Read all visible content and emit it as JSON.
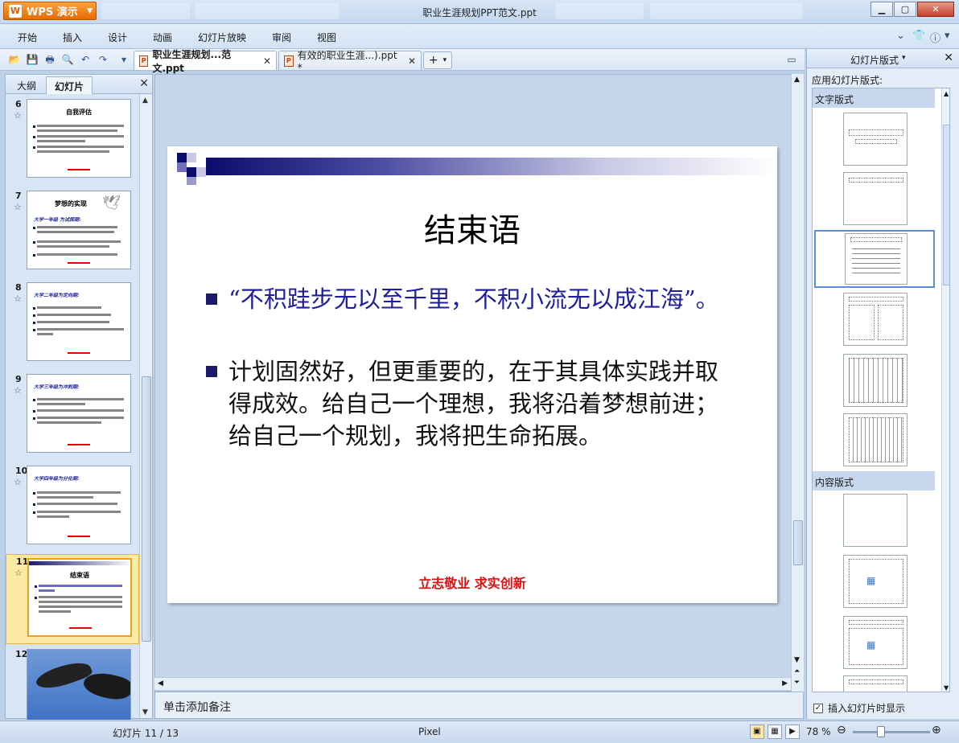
{
  "app": {
    "name": "WPS 演示",
    "logo": "W",
    "window_title": "职业生涯规划PPT范文.ppt"
  },
  "menu": [
    "开始",
    "插入",
    "设计",
    "动画",
    "幻灯片放映",
    "审阅",
    "视图"
  ],
  "tabs": [
    {
      "label": "职业生涯规划...范文.ppt",
      "active": true
    },
    {
      "label": "有效的职业生涯...).ppt *",
      "active": false
    }
  ],
  "left_panel": {
    "tabs": [
      "大纲",
      "幻灯片"
    ],
    "slides": [
      {
        "num": "6",
        "title": "自我评估"
      },
      {
        "num": "7",
        "title": "梦想的实现",
        "sub": "大学一年级 为试探期:"
      },
      {
        "num": "8",
        "sub": "大学二年级为定向期:"
      },
      {
        "num": "9",
        "sub": "大学三年级为冲刺期:"
      },
      {
        "num": "10",
        "sub": "大学四年级为分化期:"
      },
      {
        "num": "11",
        "title": "结束语"
      },
      {
        "num": "12"
      }
    ]
  },
  "slide": {
    "title": "结束语",
    "bullets": [
      "“不积跬步无以至千里，不积小流无以成江海”。",
      "计划固然好，但更重要的，在于其具体实践并取得成效。给自己一个理想，我将沿着梦想前进；给自己一个规划，我将把生命拓展。"
    ],
    "footer": "立志敬业  求实创新"
  },
  "notes_placeholder": "单击添加备注",
  "right_panel": {
    "title": "幻灯片版式",
    "apply_label": "应用幻灯片版式:",
    "section_text": "文字版式",
    "section_content": "内容版式",
    "checkbox_label": "插入幻灯片时显示"
  },
  "status": {
    "slide_info": "幻灯片 11 / 13",
    "theme": "Pixel",
    "zoom": "78 %"
  }
}
